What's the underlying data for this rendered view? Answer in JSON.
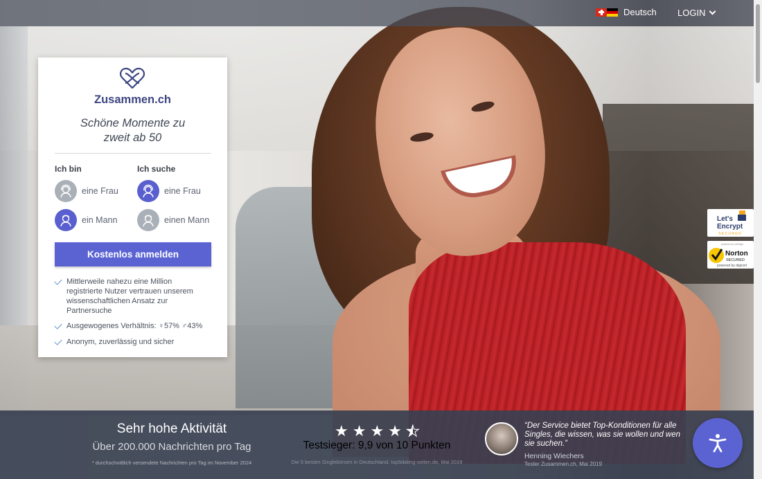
{
  "header": {
    "language_label": "Deutsch",
    "login_label": "LOGIN"
  },
  "card": {
    "brand": "Zusammen.ch",
    "tagline_line1": "Schöne Momente zu",
    "tagline_line2": "zweit ab 50",
    "i_am_heading": "Ich bin",
    "seeking_heading": "Ich suche",
    "i_am_options": [
      "eine Frau",
      "ein Mann"
    ],
    "seeking_options": [
      "eine Frau",
      "einen Mann"
    ],
    "selected": {
      "i_am": "ein Mann",
      "seeking": "eine Frau"
    },
    "cta_label": "Kostenlos anmelden",
    "bullets": [
      "Mittlerweile nahezu eine Million registrierte Nutzer vertrauen unserem wissenschaftlichen Ansatz zur Partnersuche",
      "Ausgewogenes Verhältnis: ♀57% ♂43%",
      "Anonym, zuverlässig und sicher"
    ]
  },
  "badges": {
    "letsencrypt_line1": "Let's",
    "letsencrypt_line2": "Encrypt",
    "letsencrypt_line3": "SECURED",
    "norton_top": "powered by VeriSign",
    "norton_line1": "Norton",
    "norton_line2": "SECURED",
    "norton_bottom": "powered by digicert"
  },
  "stats": {
    "activity_title": "Sehr hohe Aktivität",
    "activity_sub": "Über 200.000 Nachrichten pro Tag",
    "activity_note": "* durchschnittlich versendete Nachrichten pro Tag im November 2024",
    "rating": 4.5,
    "rating_max": 5,
    "score_text": "Testsieger: 9,9 von 10 Punkten",
    "score_note": "Die 5 besten Singlebörsen in Deutschland, top5dating-seiten.de, Mai 2019",
    "quote": "“Der Service bietet Top-Konditionen für alle Singles, die wissen, was sie wollen und wen sie suchen.”",
    "quote_author": "Henning Wiechers",
    "quote_role": "Tester Zusammen.ch, Mai 2019"
  },
  "colors": {
    "accent": "#5b63d3",
    "brand_text": "#3b4580",
    "bottom_bar": "#384050",
    "top_bar": "#464e5c"
  },
  "icons": [
    "swiss-flag-icon",
    "german-flag-icon",
    "chevron-down-icon",
    "infinity-heart-logo-icon",
    "woman-avatar-icon",
    "man-avatar-icon",
    "check-icon",
    "star-icon",
    "accessibility-icon"
  ]
}
